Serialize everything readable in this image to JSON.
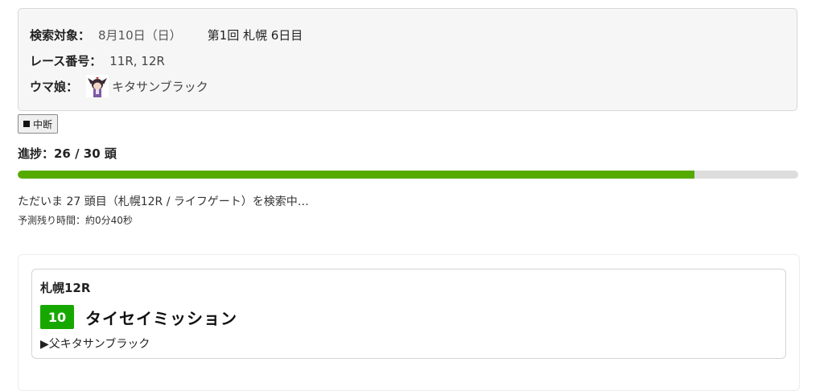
{
  "search": {
    "target_label": "検索対象：",
    "target_date": "8月10日（日）",
    "target_meeting": "第1回 札幌 6日目",
    "race_label": "レース番号：",
    "race_value": "11R, 12R",
    "umamusume_label": "ウマ娘：",
    "umamusume_value": "キタサンブラック"
  },
  "controls": {
    "stop_label": "中断"
  },
  "progress": {
    "title": "進捗：26 / 30 頭",
    "done": 26,
    "total": 30,
    "fraction": 0.8667,
    "status": "ただいま 27 頭目（札幌12R / ライフゲート）を検索中…",
    "eta": "予測残り時間：約0分40秒",
    "color": "#55aa00"
  },
  "results": [
    {
      "race": "札幌12R",
      "number": "10",
      "horse": "タイセイミッション",
      "sire": "▶父キタサンブラック",
      "number_color": "#17a800"
    }
  ]
}
